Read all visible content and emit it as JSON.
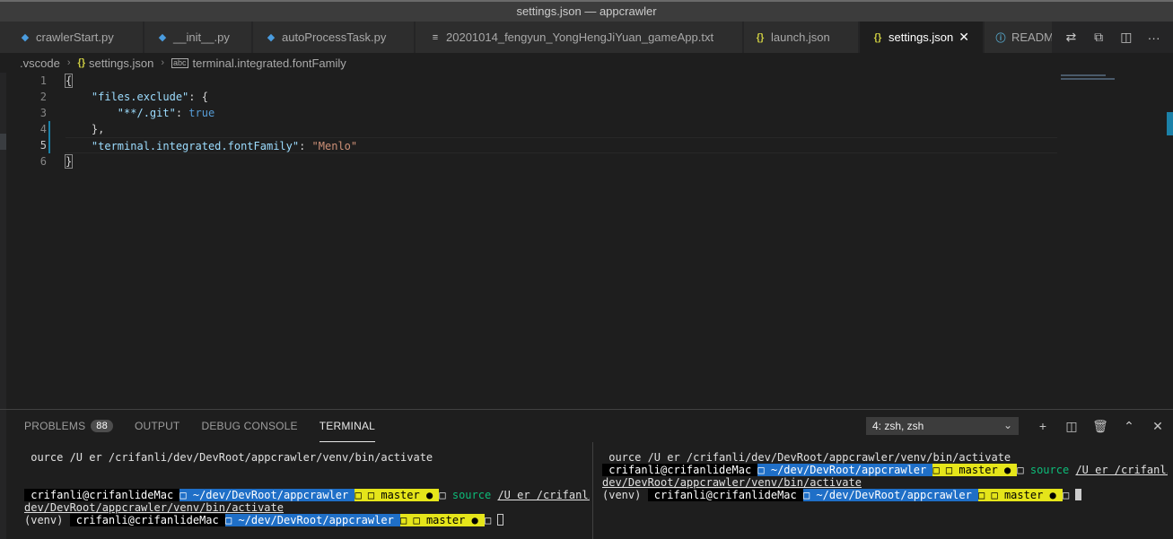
{
  "window": {
    "title": "settings.json — appcrawler"
  },
  "tabs": [
    {
      "label": "crawlerStart.py",
      "icon": "python-icon",
      "active": false
    },
    {
      "label": "__init__.py",
      "icon": "python-icon",
      "active": false
    },
    {
      "label": "autoProcessTask.py",
      "icon": "python-icon",
      "active": false
    },
    {
      "label": "20201014_fengyun_YongHengJiYuan_gameApp.txt",
      "icon": "text-file-icon",
      "active": false
    },
    {
      "label": "launch.json",
      "icon": "json-icon",
      "active": false
    },
    {
      "label": "settings.json",
      "icon": "json-icon",
      "active": true
    },
    {
      "label": "READM",
      "icon": "info-icon",
      "active": false
    }
  ],
  "tab_icons": {
    "python": "◆",
    "json": "{}",
    "text": "≡",
    "info": "ⓘ",
    "close": "✕"
  },
  "tab_actions": {
    "compare": "⇄",
    "open_changes": "⧉",
    "split": "◫",
    "more": "···"
  },
  "breadcrumb": {
    "folder": ".vscode",
    "file": "settings.json",
    "setting": "terminal.integrated.fontFamily",
    "separator": "›"
  },
  "editor": {
    "line_numbers": [
      "1",
      "2",
      "3",
      "4",
      "5",
      "6"
    ],
    "current_line": 5,
    "lines": {
      "l1_brace": "{",
      "l2_key": "\"files.exclude\"",
      "l2_rest": ": {",
      "l3_key": "\"**/.git\"",
      "l3_colon": ": ",
      "l3_value": "true",
      "l4": "},",
      "l5_key": "\"terminal.integrated.fontFamily\"",
      "l5_colon": ": ",
      "l5_value": "\"Menlo\"",
      "l6_brace": "}"
    }
  },
  "panel": {
    "tabs": {
      "problems": "PROBLEMS",
      "problems_count": "88",
      "output": "OUTPUT",
      "debug_console": "DEBUG CONSOLE",
      "terminal": "TERMINAL"
    },
    "terminal_select": "4: zsh, zsh",
    "actions": {
      "new": "+",
      "split": "◫",
      "kill": "🗑",
      "maximize": "⌃",
      "close": "✕"
    }
  },
  "terminal_left": {
    "line1": " ource /U er /crifanli/dev/DevRoot/appcrawler/venv/bin/activate",
    "p1_user": " crifanli@crifanlideMac ",
    "p1_dir": "□ ~/dev/DevRoot/appcrawler ",
    "p1_git": "□ □ master ● ",
    "p1_tail": "□ ",
    "p1_cmd": "source",
    "p1_arg": "/U er /crifanli/",
    "line3": "dev/DevRoot/appcrawler/venv/bin/activate",
    "venv": "(venv) ",
    "p2_user": " crifanli@crifanlideMac ",
    "p2_dir": "□ ~/dev/DevRoot/appcrawler ",
    "p2_git": "□ □ master ● ",
    "p2_tail": "□ "
  },
  "terminal_right": {
    "line1": " ource /U er /crifanli/dev/DevRoot/appcrawler/venv/bin/activate",
    "p1_user": " crifanli@crifanlideMac ",
    "p1_dir": "□ ~/dev/DevRoot/appcrawler ",
    "p1_git": "□ □ master ● ",
    "p1_tail": "□ ",
    "p1_cmd": "source",
    "p1_arg": "/U er /crifanli/",
    "line3": "dev/DevRoot/appcrawler/venv/bin/activate",
    "venv": "(venv) ",
    "p2_user": " crifanli@crifanlideMac ",
    "p2_dir": "□ ~/dev/DevRoot/appcrawler ",
    "p2_git": "□ □ master ● ",
    "p2_tail": "□ "
  }
}
